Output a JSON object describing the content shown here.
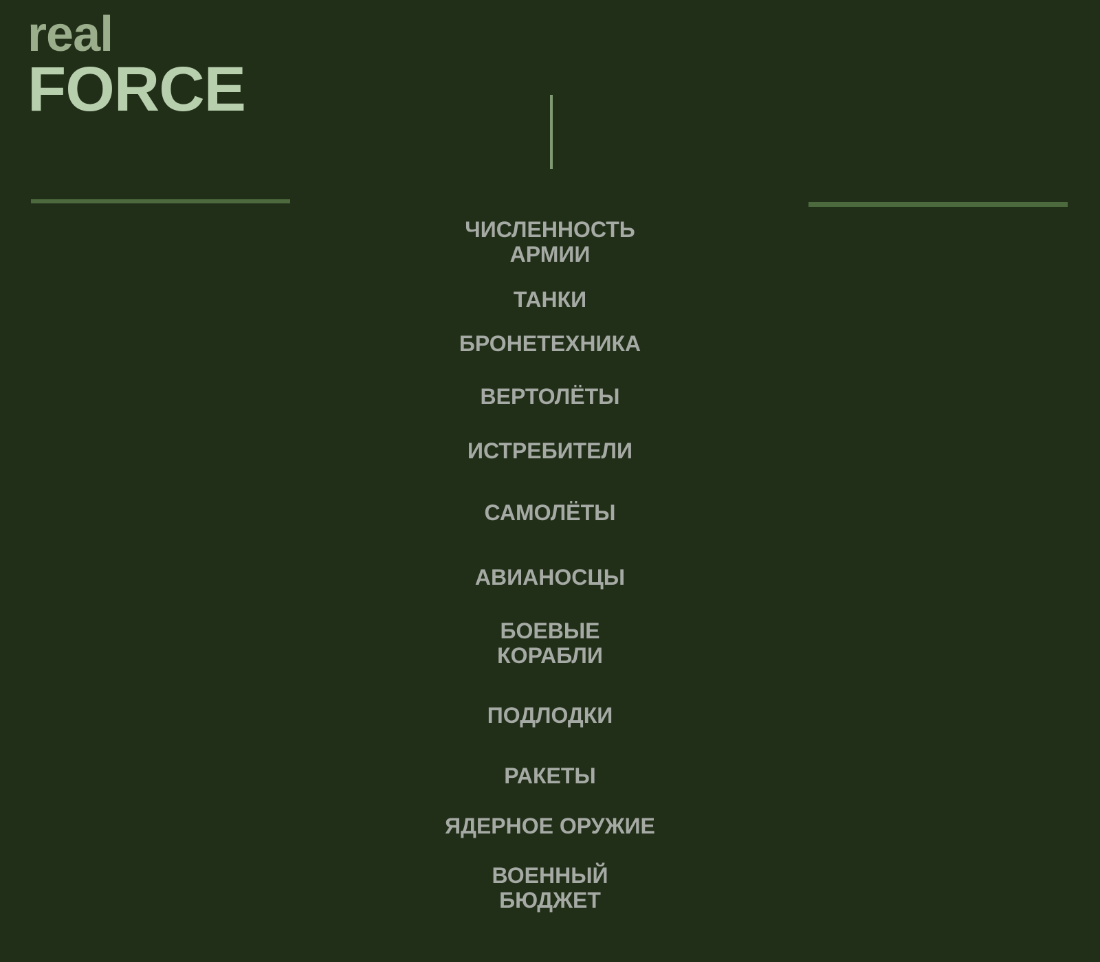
{
  "logo": {
    "line1": "real",
    "line2": "FORCE"
  },
  "menu": {
    "items": [
      {
        "lines": [
          "ЧИСЛЕННОСТЬ",
          "АРМИИ"
        ]
      },
      {
        "lines": [
          "ТАНКИ"
        ]
      },
      {
        "lines": [
          "БРОНЕТЕХНИКА"
        ]
      },
      {
        "lines": [
          "ВЕРТОЛЁТЫ"
        ]
      },
      {
        "lines": [
          "ИСТРЕБИТЕЛИ"
        ]
      },
      {
        "lines": [
          "САМОЛЁТЫ"
        ]
      },
      {
        "lines": [
          "АВИАНОСЦЫ"
        ]
      },
      {
        "lines": [
          "БОЕВЫЕ",
          "КОРАБЛИ"
        ]
      },
      {
        "lines": [
          "ПОДЛОДКИ"
        ]
      },
      {
        "lines": [
          "РАКЕТЫ"
        ]
      },
      {
        "lines": [
          "ЯДЕРНОЕ ОРУЖИЕ"
        ]
      },
      {
        "lines": [
          "ВОЕННЫЙ",
          "БЮДЖЕТ"
        ]
      }
    ]
  },
  "colors": {
    "background": "#212e18",
    "logo_real": "#9aae8c",
    "logo_force": "#b8cfae",
    "menu_text": "#a6aaa4",
    "rule": "#4d6a3f",
    "divider": "#7f9a72"
  }
}
